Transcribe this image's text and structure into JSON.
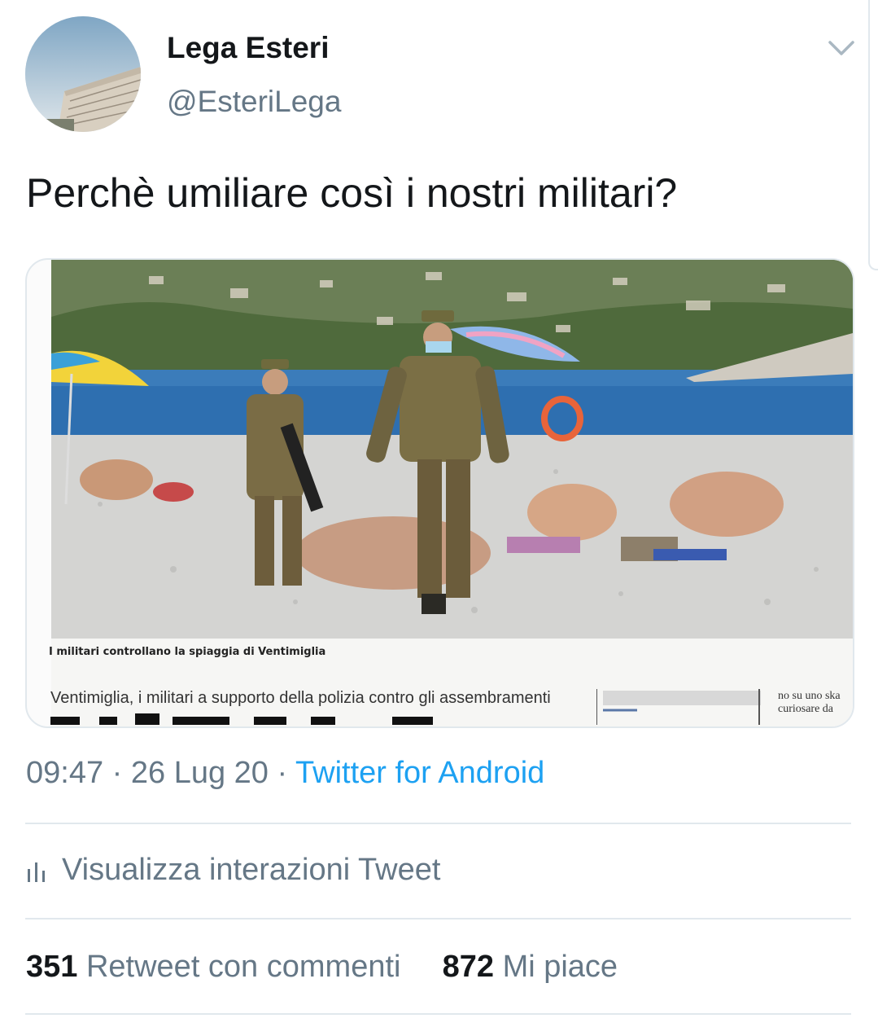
{
  "author": {
    "name": "Lega Esteri",
    "handle": "@EsteriLega"
  },
  "tweet": {
    "text": "Perchè umiliare così i nostri militari?"
  },
  "media": {
    "caption": "I militari controllano la spiaggia di Ventimiglia",
    "headline": "Ventimiglia, i militari a supporto della polizia contro gli assembramenti",
    "side_text": [
      "no su uno ska",
      "curiosare da"
    ]
  },
  "meta": {
    "time": "09:47",
    "date": "26 Lug 20",
    "source": "Twitter for Android"
  },
  "analytics": {
    "label": "Visualizza interazioni Tweet"
  },
  "stats": {
    "retweets_count": "351",
    "retweets_label": "Retweet con commenti",
    "likes_count": "872",
    "likes_label": "Mi piace"
  },
  "colors": {
    "text_primary": "#14171a",
    "text_secondary": "#657786",
    "link": "#1da1f2",
    "divider": "#e1e8ed"
  }
}
